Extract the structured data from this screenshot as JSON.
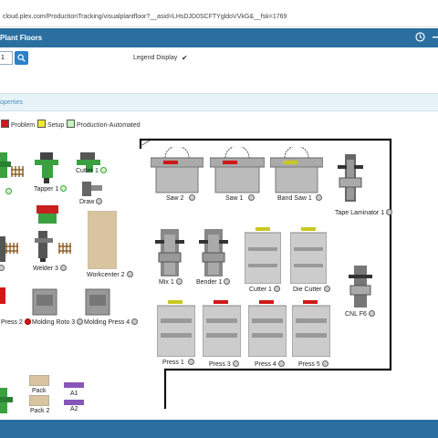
{
  "browser": {
    "url": "cloud.plex.com/ProductionTracking/visualplantfloor?__asid=LHsDJD0SCFTYgldoVVkG&__fsk=1769"
  },
  "header": {
    "title": "Plant Floors",
    "clock_icon": "clock-icon",
    "menu_icon": "menu-icon"
  },
  "toolbar": {
    "plant_value": "1",
    "search_icon": "search-icon",
    "legend_display_label": "Legend Display",
    "legend_display_checked": "✔"
  },
  "properties": {
    "label": "operties"
  },
  "legend": [
    {
      "label": "Problem",
      "color": "#d01818"
    },
    {
      "label": "Setup",
      "color": "#f2e832"
    },
    {
      "label": "Production-Automated",
      "color": "#c8f0c0"
    }
  ],
  "machines": {
    "tapper1": "Tapper 1",
    "cutter1_left": "Cutter 1",
    "draw": "Draw",
    "welder3": "Welder 3",
    "workcenter2": "Workcenter 2",
    "press2": "Press 2",
    "molding_roto3": "Molding Roto 3",
    "molding_press4": "Molding Press 4",
    "pack": "Pack",
    "pack2": "Pack 2",
    "a1": "A1",
    "a2": "A2",
    "saw2": "Saw 2",
    "saw1": "Saw 1",
    "band_saw1": "Band Saw 1",
    "tape_laminator1": "Tape Laminator 1",
    "mix1": "Mix 1",
    "bender1": "Bender 1",
    "cutter1_right": "Cutter 1",
    "die_cutter": "Die Cutter",
    "cnl_f6": "CNL F6",
    "press1": "Press 1",
    "press3": "Press 3",
    "press4": "Press 4",
    "press5": "Press 5"
  },
  "colors": {
    "header": "#2a6fa0",
    "problem": "#d01818",
    "setup": "#e8e030",
    "automated": "#c8f0c0"
  }
}
